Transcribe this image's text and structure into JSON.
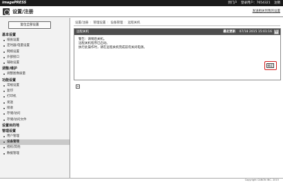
{
  "app": {
    "brand": "imagePRESS",
    "title": "设置/注册",
    "top_right_link": "发送相关到我的设置"
  },
  "top_links": [
    "到门户",
    "登录用户：7654321",
    "注销"
  ],
  "sidebar": {
    "button_label": "复位全部设置",
    "items": [
      {
        "type": "group",
        "label": "基本设置"
      },
      {
        "type": "item",
        "label": "纸张设置"
      },
      {
        "type": "item",
        "label": "定时器/电量设置"
      },
      {
        "type": "item",
        "label": "网络设置"
      },
      {
        "type": "item",
        "label": "外部接口"
      },
      {
        "type": "item",
        "label": "辅助设置"
      },
      {
        "type": "group",
        "label": "调整/维护"
      },
      {
        "type": "item",
        "label": "调整图像质量"
      },
      {
        "type": "group",
        "label": "功能设置"
      },
      {
        "type": "item",
        "label": "常规设置"
      },
      {
        "type": "item",
        "label": "复印"
      },
      {
        "type": "item",
        "label": "打印机"
      },
      {
        "type": "item",
        "label": "发送"
      },
      {
        "type": "item",
        "label": "接收"
      },
      {
        "type": "item",
        "label": "存储/访问"
      },
      {
        "type": "item",
        "label": "存储/访问文件"
      },
      {
        "type": "group",
        "label": "设置目的地"
      },
      {
        "type": "group",
        "label": "管理设置"
      },
      {
        "type": "item",
        "label": "用户管理"
      },
      {
        "type": "item",
        "label": "设备管理",
        "active": true
      },
      {
        "type": "item",
        "label": "授权/其他"
      },
      {
        "type": "item",
        "label": "数据管理"
      }
    ]
  },
  "breadcrumb": [
    "设置/注册",
    "管理设置",
    "设备管理",
    "远程关机"
  ],
  "panel": {
    "title": "远程关机",
    "meta_label": "最近更新",
    "meta_value": "07/18 2015 15:01:16",
    "refresh_symbol": "↻",
    "messages": [
      "警告：请稍后关机。",
      "远程关机程序已启动。",
      "执行此操作时，请在远程关机完成前勿关闭电源。"
    ],
    "ok_label": "确定"
  },
  "page_icon_symbol": "≡",
  "footer": {
    "copyright": "Copyright CANON INC. 2015"
  }
}
